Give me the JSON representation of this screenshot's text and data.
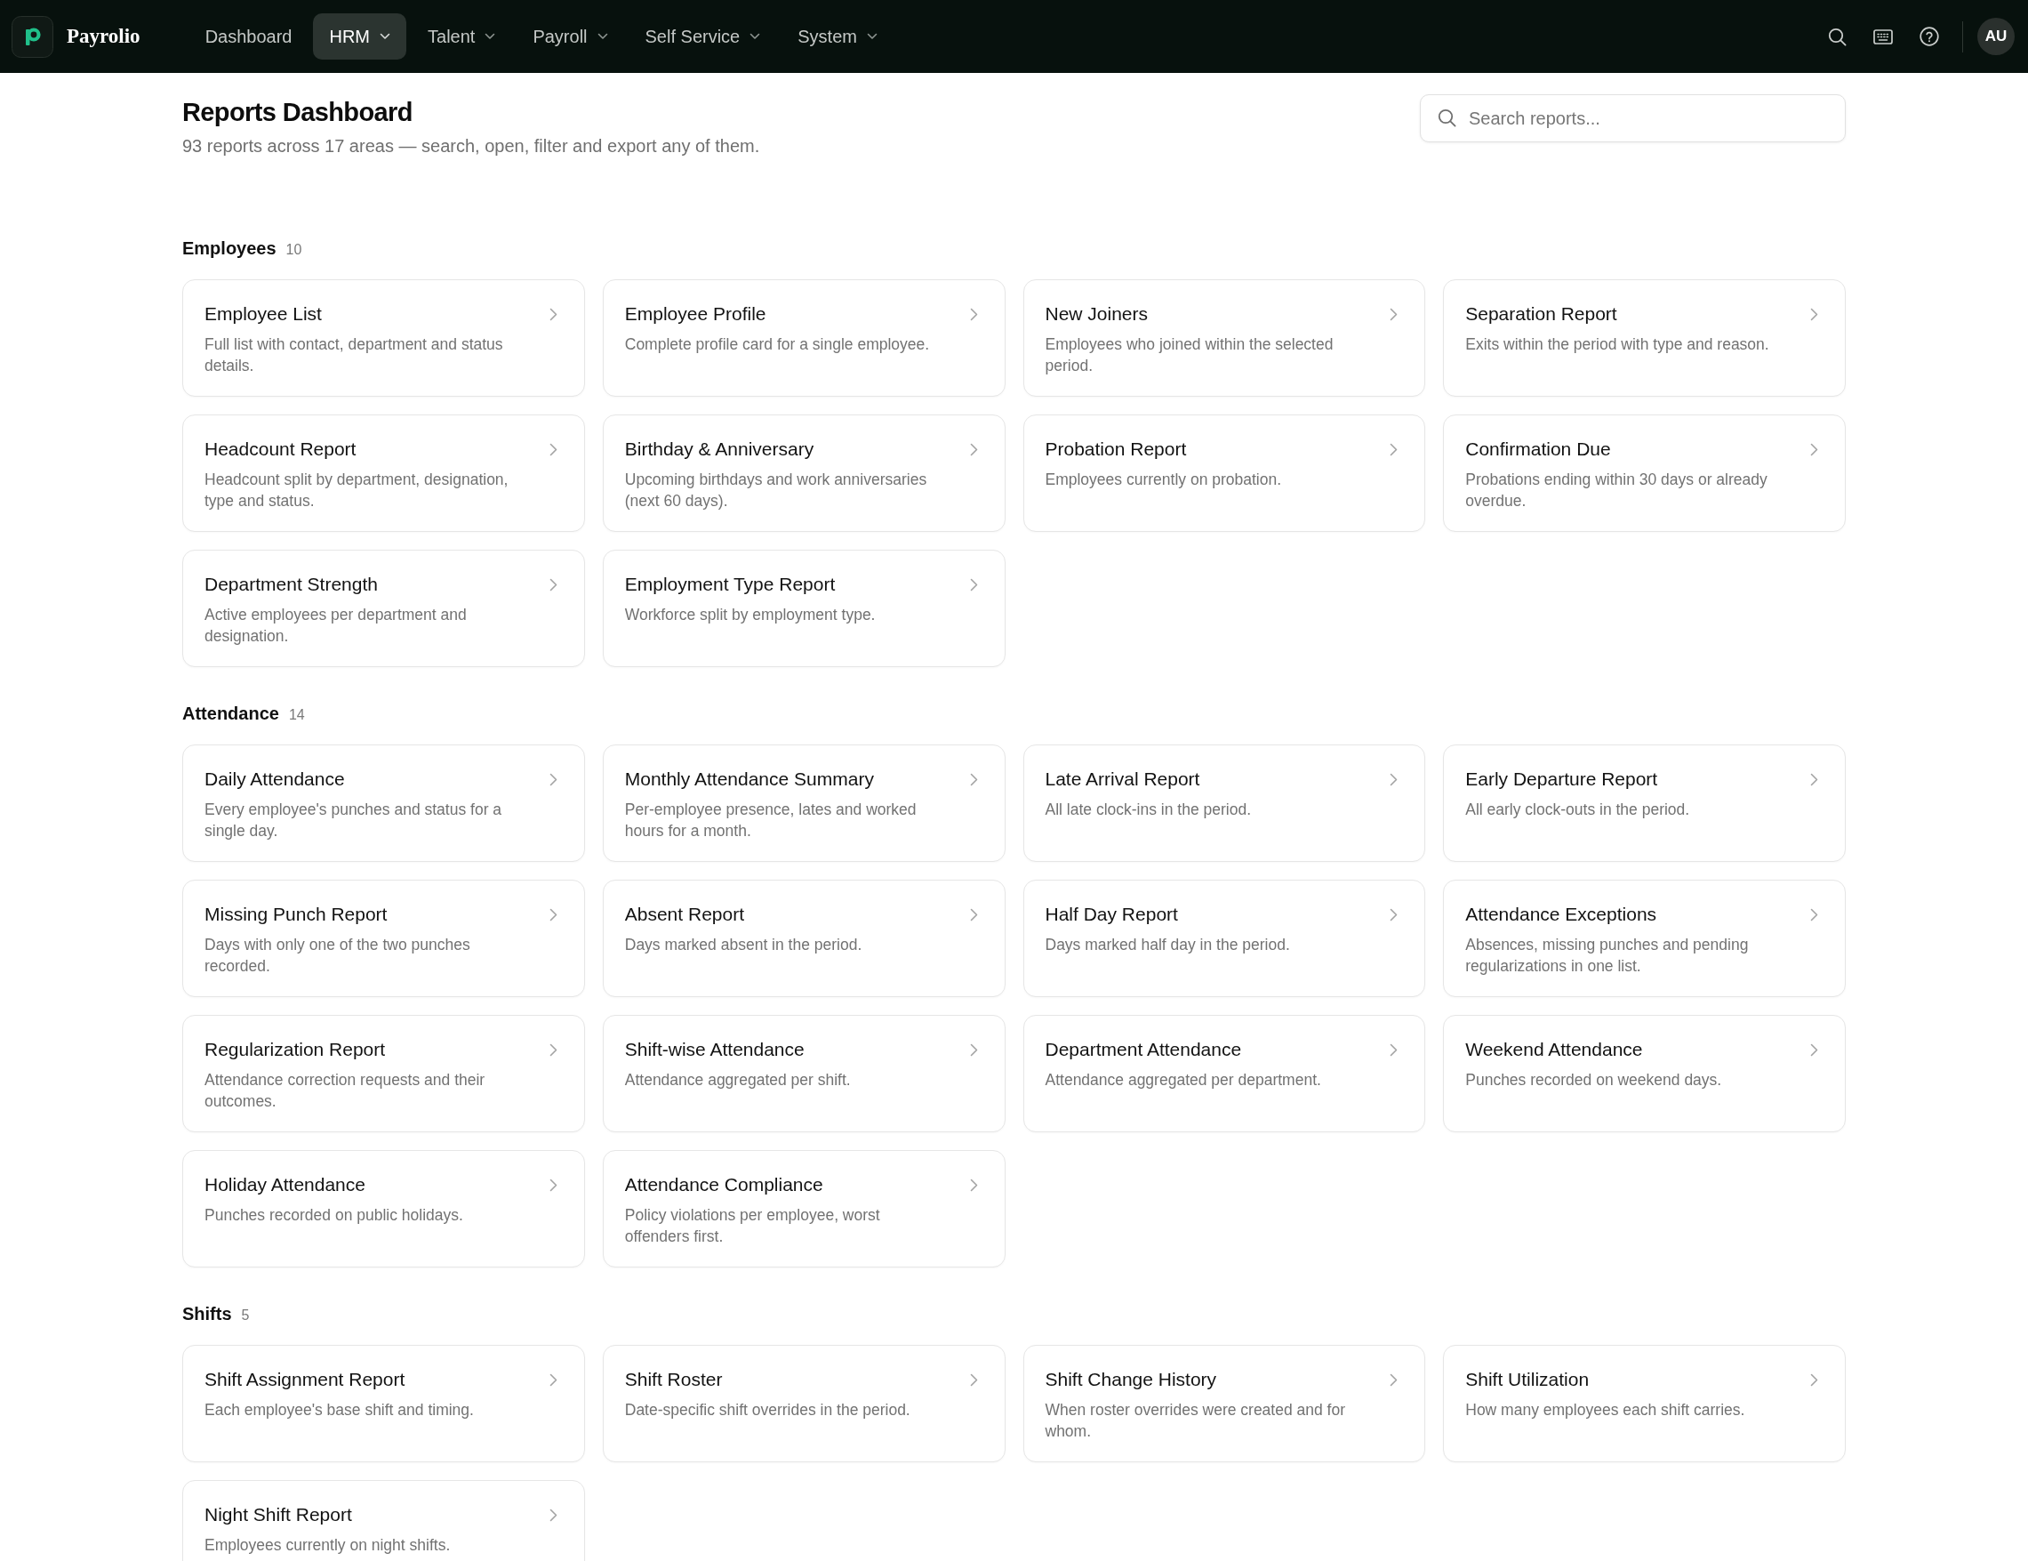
{
  "nav": {
    "brand": "Payrolio",
    "items": [
      {
        "label": "Dashboard",
        "selected": false,
        "has_menu": false
      },
      {
        "label": "HRM",
        "selected": true,
        "has_menu": true
      },
      {
        "label": "Talent",
        "selected": false,
        "has_menu": true
      },
      {
        "label": "Payroll",
        "selected": false,
        "has_menu": true
      },
      {
        "label": "Self Service",
        "selected": false,
        "has_menu": true
      },
      {
        "label": "System",
        "selected": false,
        "has_menu": true
      }
    ],
    "avatar": "AU"
  },
  "header": {
    "title": "Reports Dashboard",
    "subtitle": "93 reports across 17 areas — search, open, filter and export any of them.",
    "search": {
      "placeholder": "Search reports..."
    }
  },
  "sections": [
    {
      "title": "Employees",
      "count": "10",
      "reports": [
        {
          "title": "Employee List",
          "description": "Full list with contact, department and status details."
        },
        {
          "title": "Employee Profile",
          "description": "Complete profile card for a single employee."
        },
        {
          "title": "New Joiners",
          "description": "Employees who joined within the selected period."
        },
        {
          "title": "Separation Report",
          "description": "Exits within the period with type and reason."
        },
        {
          "title": "Headcount Report",
          "description": "Headcount split by department, designation, type and status."
        },
        {
          "title": "Birthday & Anniversary",
          "description": "Upcoming birthdays and work anniversaries (next 60 days)."
        },
        {
          "title": "Probation Report",
          "description": "Employees currently on probation."
        },
        {
          "title": "Confirmation Due",
          "description": "Probations ending within 30 days or already overdue."
        },
        {
          "title": "Department Strength",
          "description": "Active employees per department and designation."
        },
        {
          "title": "Employment Type Report",
          "description": "Workforce split by employment type."
        }
      ]
    },
    {
      "title": "Attendance",
      "count": "14",
      "reports": [
        {
          "title": "Daily Attendance",
          "description": "Every employee's punches and status for a single day."
        },
        {
          "title": "Monthly Attendance Summary",
          "description": "Per-employee presence, lates and worked hours for a month."
        },
        {
          "title": "Late Arrival Report",
          "description": "All late clock-ins in the period."
        },
        {
          "title": "Early Departure Report",
          "description": "All early clock-outs in the period."
        },
        {
          "title": "Missing Punch Report",
          "description": "Days with only one of the two punches recorded."
        },
        {
          "title": "Absent Report",
          "description": "Days marked absent in the period."
        },
        {
          "title": "Half Day Report",
          "description": "Days marked half day in the period."
        },
        {
          "title": "Attendance Exceptions",
          "description": "Absences, missing punches and pending regularizations in one list."
        },
        {
          "title": "Regularization Report",
          "description": "Attendance correction requests and their outcomes."
        },
        {
          "title": "Shift-wise Attendance",
          "description": "Attendance aggregated per shift."
        },
        {
          "title": "Department Attendance",
          "description": "Attendance aggregated per department."
        },
        {
          "title": "Weekend Attendance",
          "description": "Punches recorded on weekend days."
        },
        {
          "title": "Holiday Attendance",
          "description": "Punches recorded on public holidays."
        },
        {
          "title": "Attendance Compliance",
          "description": "Policy violations per employee, worst offenders first."
        }
      ]
    },
    {
      "title": "Shifts",
      "count": "5",
      "reports": [
        {
          "title": "Shift Assignment Report",
          "description": "Each employee's base shift and timing."
        },
        {
          "title": "Shift Roster",
          "description": "Date-specific shift overrides in the period."
        },
        {
          "title": "Shift Change History",
          "description": "When roster overrides were created and for whom."
        },
        {
          "title": "Shift Utilization",
          "description": "How many employees each shift carries."
        },
        {
          "title": "Night Shift Report",
          "description": "Employees currently on night shifts."
        }
      ]
    }
  ]
}
